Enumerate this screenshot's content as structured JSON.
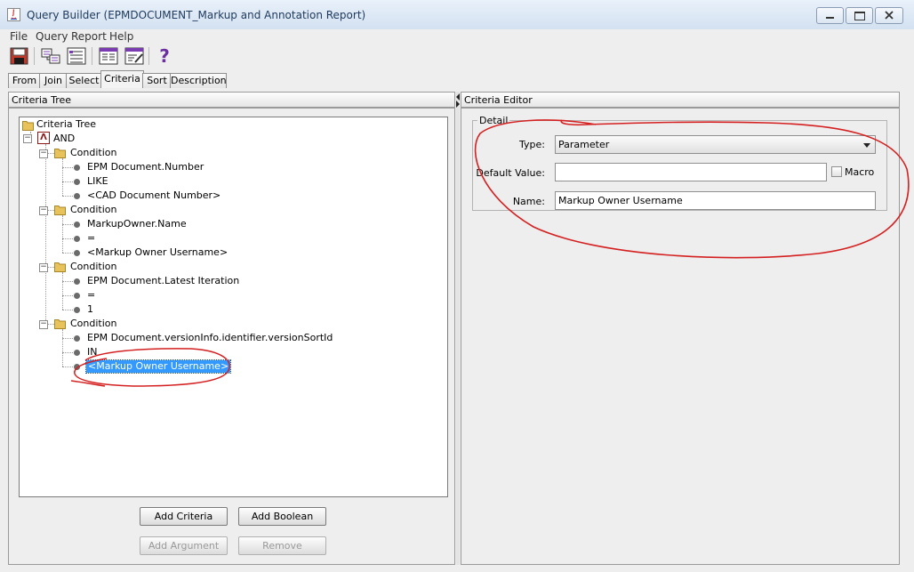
{
  "window": {
    "title": "Query Builder (EPMDOCUMENT_Markup and Annotation Report)",
    "controls": [
      "minimize",
      "maximize",
      "close"
    ]
  },
  "menubar": {
    "items": [
      {
        "label": "File"
      },
      {
        "label": "Query"
      },
      {
        "label": "Report"
      },
      {
        "label": "Help"
      }
    ]
  },
  "toolbar": {
    "icons": [
      "save-icon",
      "join-icon",
      "select-list-icon",
      "report-icon",
      "edit-report-icon",
      "help-icon"
    ],
    "help_glyph": "?"
  },
  "tabs": [
    {
      "label": "From",
      "active": false
    },
    {
      "label": "Join",
      "active": false
    },
    {
      "label": "Select",
      "active": false
    },
    {
      "label": "Criteria",
      "active": true
    },
    {
      "label": "Sort",
      "active": false
    },
    {
      "label": "Description",
      "active": false
    }
  ],
  "left_panel": {
    "header": "Criteria Tree",
    "tree": {
      "root": "Criteria Tree",
      "and_label": "AND",
      "and_glyph": "Λ",
      "conditions": [
        {
          "label": "Condition",
          "items": [
            "EPM Document.Number",
            "LIKE",
            "<CAD Document Number>"
          ]
        },
        {
          "label": "Condition",
          "items": [
            "MarkupOwner.Name",
            "=",
            "<Markup Owner Username>"
          ]
        },
        {
          "label": "Condition",
          "items": [
            "EPM Document.Latest Iteration",
            "=",
            "1"
          ]
        },
        {
          "label": "Condition",
          "items": [
            "EPM Document.versionInfo.identifier.versionSortId",
            "IN",
            "<Markup Owner Username>"
          ]
        }
      ],
      "selected": "<Markup Owner Username>"
    },
    "buttons": {
      "add_criteria": "Add Criteria",
      "add_boolean": "Add Boolean",
      "add_argument": "Add Argument",
      "remove": "Remove"
    }
  },
  "right_panel": {
    "header": "Criteria Editor",
    "group_label": "Detail",
    "type_label": "Type:",
    "type_value": "Parameter",
    "default_label": "Default Value:",
    "default_value": "",
    "macro_label": "Macro",
    "macro_checked": false,
    "name_label": "Name:",
    "name_value": "Markup Owner Username"
  },
  "colors": {
    "selection": "#3399ff",
    "annotation": "#d42020"
  }
}
